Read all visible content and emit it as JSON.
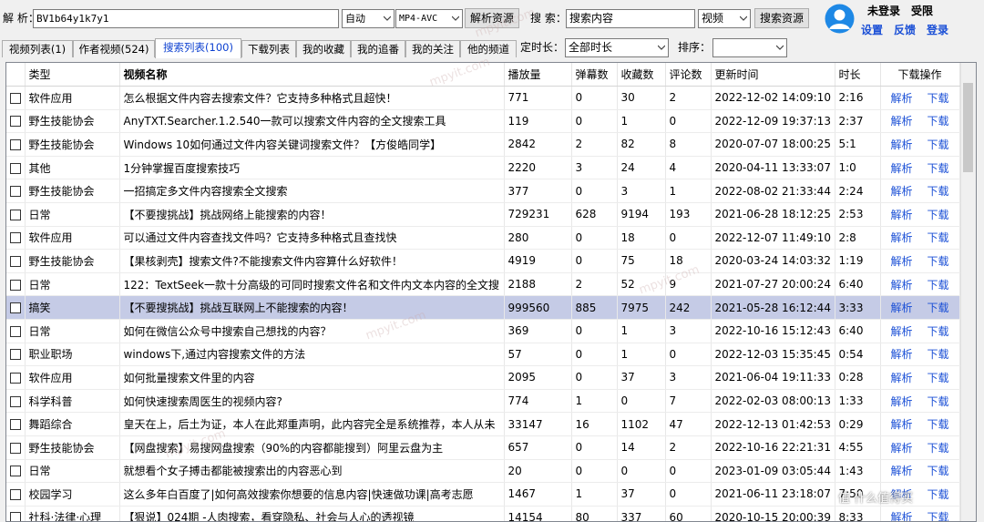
{
  "toolbar": {
    "parse_label": "解 析：",
    "bv_value": "BV1b64y1k7y1",
    "mode_value": "自动",
    "format_value": "MP4-AVC",
    "parse_button": "解析资源",
    "search_label": "搜 索：",
    "search_value": "搜索内容",
    "search_type_value": "视频",
    "search_button": "搜索资源",
    "user_status": "未登录",
    "user_limit": "受限",
    "settings_link": "设置",
    "feedback_link": "反馈",
    "login_link": "登录"
  },
  "tabs": [
    {
      "label": "视频列表(1)"
    },
    {
      "label": "作者视频(524)"
    },
    {
      "label": "搜索列表(100)"
    },
    {
      "label": "下载列表"
    },
    {
      "label": "我的收藏"
    },
    {
      "label": "我的追番"
    },
    {
      "label": "我的关注"
    },
    {
      "label": "他的频道"
    }
  ],
  "filters": {
    "duration_label": "定时长：",
    "duration_value": "全部时长",
    "sort_label": "排序：",
    "sort_value": ""
  },
  "table": {
    "columns": [
      "类型",
      "视频名称",
      "播放量",
      "弹幕数",
      "收藏数",
      "评论数",
      "更新时间",
      "时长",
      "下载操作"
    ],
    "action_parse": "解析",
    "action_download": "下载",
    "rows": [
      [
        "软件应用",
        "怎么根据文件内容去搜索文件？它支持多种格式且超快！",
        "771",
        "0",
        "30",
        "2",
        "2022-12-02 14:09:10",
        "2:16"
      ],
      [
        "野生技能协会",
        "AnyTXT.Searcher.1.2.540一款可以搜索文件内容的全文搜索工具",
        "119",
        "0",
        "1",
        "0",
        "2022-12-09 19:37:13",
        "2:37"
      ],
      [
        "野生技能协会",
        "Windows 10如何通过文件内容关键词搜索文件？【方俊皓同学】",
        "2842",
        "2",
        "82",
        "8",
        "2020-07-07 18:00:25",
        "5:1"
      ],
      [
        "其他",
        "1分钟掌握百度搜索技巧",
        "2220",
        "3",
        "24",
        "4",
        "2020-04-11 13:33:07",
        "1:0"
      ],
      [
        "野生技能协会",
        "一招搞定多文件内容搜索全文搜索",
        "377",
        "0",
        "3",
        "1",
        "2022-08-02 21:33:44",
        "2:24"
      ],
      [
        "日常",
        "【不要搜挑战】挑战网络上能搜索的内容！",
        "729231",
        "628",
        "9194",
        "193",
        "2021-06-28 18:12:25",
        "2:53"
      ],
      [
        "软件应用",
        "可以通过文件内容查找文件吗？它支持多种格式且查找快",
        "280",
        "0",
        "18",
        "0",
        "2022-12-07 11:49:10",
        "2:8"
      ],
      [
        "野生技能协会",
        "【果核剥壳】搜索文件?不能搜索文件内容算什么好软件！",
        "4919",
        "0",
        "75",
        "18",
        "2020-03-24 14:03:32",
        "1:19"
      ],
      [
        "日常",
        "122：TextSeek一款十分高级的可同时搜索文件名和文件内文本内容的全文搜",
        "2188",
        "2",
        "52",
        "9",
        "2021-07-27 20:00:24",
        "6:40"
      ],
      [
        "搞笑",
        "【不要搜挑战】挑战互联网上不能搜索的内容！",
        "999560",
        "885",
        "7975",
        "242",
        "2021-05-28 16:12:44",
        "3:33"
      ],
      [
        "日常",
        "如何在微信公众号中搜索自己想找的内容？",
        "369",
        "0",
        "1",
        "3",
        "2022-10-16 15:12:43",
        "6:40"
      ],
      [
        "职业职场",
        "windows下,通过内容搜索文件的方法",
        "57",
        "0",
        "1",
        "0",
        "2022-12-03 15:35:45",
        "0:54"
      ],
      [
        "软件应用",
        "如何批量搜索文件里的内容",
        "2095",
        "0",
        "37",
        "3",
        "2021-06-04 19:11:33",
        "0:28"
      ],
      [
        "科学科普",
        "如何快速搜索周医生的视频内容?",
        "774",
        "1",
        "0",
        "7",
        "2022-02-03 08:00:13",
        "1:33"
      ],
      [
        "舞蹈综合",
        "皇天在上，后土为证，本人在此郑重声明，此内容完全是系统推荐，本人从未",
        "33147",
        "16",
        "1102",
        "47",
        "2022-12-13 01:42:53",
        "0:29"
      ],
      [
        "野生技能协会",
        "【网盘搜索】易搜网盘搜索（90%的内容都能搜到）阿里云盘为主",
        "657",
        "0",
        "14",
        "2",
        "2022-10-16 22:21:31",
        "4:55"
      ],
      [
        "日常",
        "就想看个女子搏击都能被搜索出的内容恶心到",
        "20",
        "0",
        "0",
        "0",
        "2023-01-09 03:05:44",
        "1:43"
      ],
      [
        "校园学习",
        "这么多年白百度了|如何高效搜索你想要的信息内容|快速做功课|高考志愿",
        "1467",
        "1",
        "37",
        "0",
        "2021-06-11 23:18:07",
        "7:50"
      ],
      [
        "社科·法律·心理",
        "【狠说】024期 -人肉搜索，看穿隐私、社会与人心的透视镜",
        "14154",
        "80",
        "337",
        "60",
        "2020-10-15 20:00:39",
        "8:33"
      ]
    ],
    "selected_row": 9
  },
  "watermark": "mpyit.com",
  "corner_watermark": "值 什么值得买"
}
